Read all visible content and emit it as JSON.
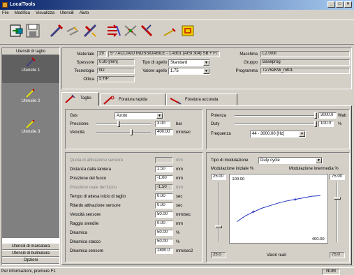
{
  "window": {
    "title": "LocalTools",
    "min": "_",
    "max": "□",
    "close": "×"
  },
  "menu": [
    "File",
    "Modifica",
    "Visualizza",
    "Utensili",
    "Aiuto"
  ],
  "toolbar": {
    "icons": [
      "export-icon",
      "save-icon",
      "tool-single-icon",
      "tool-multi-icon",
      "tool-cross-icon",
      "transfer-icon",
      "swap-icon",
      "tool-red-icon",
      "wand-icon",
      "notes-icon"
    ]
  },
  "sidebar": {
    "header": "Utensili di taglio",
    "items": [
      "Utensile 1",
      "Utensile 2",
      "Utensile 3"
    ],
    "footer": [
      "Utensili di marcatura",
      "Utensili di bulinatura",
      "Opzioni"
    ]
  },
  "info": {
    "materiale_label": "Materiale",
    "materiale_code": "29",
    "materiale_value": "5° / ACCIAIO INOSSIDABILE - 1.4301 (AISI 304) SB + FI",
    "spessore_label": "Spessore",
    "spessore_value": "0.80 [mm]",
    "tipougello_label": "Tipo di ugello",
    "tipougello_value": "Standard",
    "tecnologia_label": "Tecnologia",
    "tecnologia_value": "N2",
    "valoreugello_label": "Valore ugello",
    "valoreugello_value": "1.75",
    "ottica_label": "Ottica",
    "ottica_value": "5\"HP",
    "macchina_label": "Macchina",
    "macchina_value": "L2.003l",
    "gruppo_label": "Gruppo",
    "gruppo_value": "Baseprog",
    "programma_label": "Programma",
    "programma_value": "T2762KW_mt01"
  },
  "tabs": [
    "Taglio",
    "Foratura rapida",
    "Foratura accurata"
  ],
  "gas": {
    "gas_label": "Gas",
    "gas_value": "Azoto",
    "pressione_label": "Pressione",
    "pressione_value": "3.00",
    "pressione_unit": "bar",
    "velocita_label": "Velocità",
    "velocita_value": "400.00",
    "velocita_unit": "mm/sec",
    "pressione_level": 0.4,
    "velocita_level": 0.65
  },
  "power": {
    "potenza_label": "Potenza",
    "potenza_value": "3000.0",
    "potenza_unit": "Watt",
    "duty_label": "Duty",
    "duty_value": "100.0",
    "duty_unit": "%",
    "freq_label": "Frequenza",
    "freq_value": "44 - 3000.00 [Hz]",
    "potenza_level": 1.0,
    "duty_level": 1.0
  },
  "params": {
    "rows": [
      {
        "label": "Quota di attivazione sensore",
        "value": "",
        "unit": "mm",
        "dim": true
      },
      {
        "label": "Distanza dalla lamiera",
        "value": "1.50",
        "unit": "mm",
        "dim": false
      },
      {
        "label": "Posizione del fuoco",
        "value": "-1.00",
        "unit": "mm",
        "dim": false
      },
      {
        "label": "Posizione reale del fuoco",
        "value": "-1.50",
        "unit": "mm",
        "dim": true
      },
      {
        "label": "Tempo di attesa inizio di taglio",
        "value": "0.00",
        "unit": "sec",
        "dim": false
      },
      {
        "label": "Ritardo attivazione sensore",
        "value": "0.00",
        "unit": "sec",
        "dim": false
      },
      {
        "label": "Velocità sensore",
        "value": "50.00",
        "unit": "mm/sec",
        "dim": false
      },
      {
        "label": "Raggio stendile",
        "value": "0.00",
        "unit": "mm",
        "dim": false
      },
      {
        "label": "Dinamica",
        "value": "50.00",
        "unit": "%",
        "dim": false
      },
      {
        "label": "Dinamica stacco",
        "value": "50.00",
        "unit": "%",
        "dim": false
      },
      {
        "label": "Dinamica sensore",
        "value": "1800.0",
        "unit": "mm/sec2",
        "dim": false
      }
    ]
  },
  "mod": {
    "tipo_label": "Tipo di modulazione",
    "tipo_value": "Duty cycle",
    "iniziale_label": "Modulazione iniziale %",
    "intermedia_label": "Modulazione intermedia %",
    "iniziale_value": "25.00",
    "intermedia_value": "75.00",
    "bottom_left": "25.0",
    "bottom_right": "75.0",
    "valori_label": "Valori reali",
    "iniziale_level": 0.25,
    "intermedia_level": 0.75
  },
  "chart_data": {
    "type": "line",
    "top_label": "100.00",
    "x_label": "400.00",
    "series": [
      {
        "x": [
          0,
          40,
          80,
          120,
          160,
          200,
          240,
          280,
          320,
          360,
          400
        ],
        "y": [
          25,
          36,
          44,
          51,
          56,
          61,
          65,
          68,
          71,
          74,
          75
        ]
      }
    ]
  },
  "status": {
    "message": "Per informazioni, premere F1",
    "num": "NUM"
  }
}
